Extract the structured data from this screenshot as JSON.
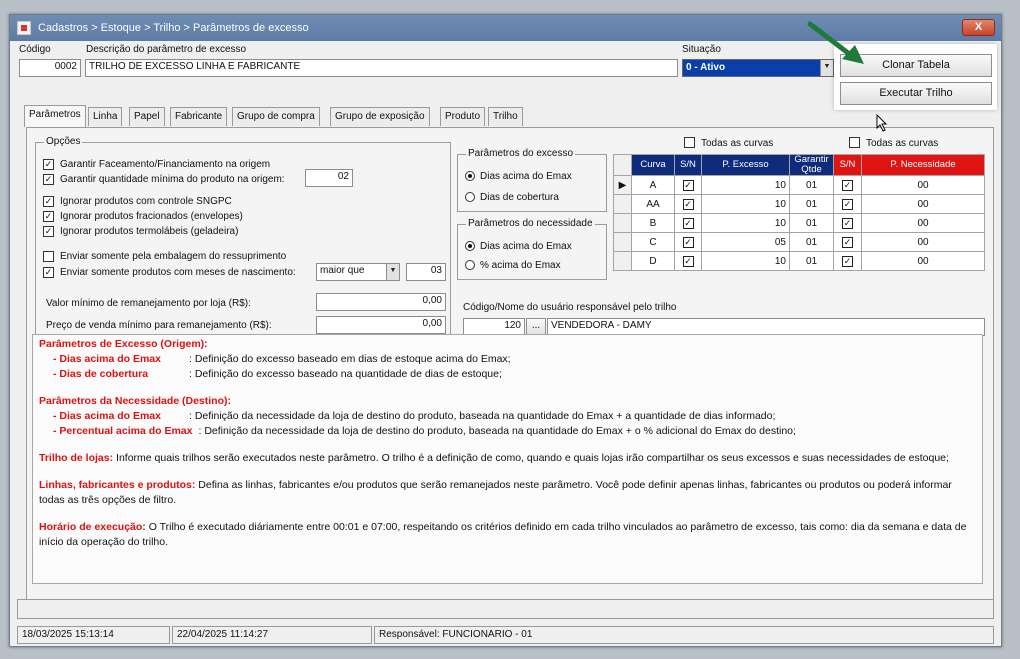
{
  "window": {
    "title": "Cadastros > Estoque > Trilho > Parâmetros de excesso",
    "close_label": "X"
  },
  "header": {
    "codigo_label": "Código",
    "codigo_value": "0002",
    "descricao_label": "Descrição do parâmetro de excesso",
    "descricao_value": "TRILHO DE EXCESSO LINHA E FABRICANTE",
    "situacao_label": "Situação",
    "situacao_value": "0 - Ativo"
  },
  "actions": {
    "clonar_label": "Clonar Tabela",
    "executar_label": "Executar Trilho"
  },
  "tabs": [
    "Parâmetros",
    "Linha",
    "Papel",
    "Fabricante",
    "Grupo de compra",
    "Grupo de exposição",
    "Produto",
    "Trilho"
  ],
  "opcoes": {
    "title": "Opções",
    "items": [
      {
        "label": "Garantir Faceamento/Financiamento na origem",
        "checked": true
      },
      {
        "label": "Garantir quantidade mínima do produto na origem:",
        "checked": true,
        "value": "02"
      },
      {
        "label": "Ignorar produtos com controle SNGPC",
        "checked": true
      },
      {
        "label": "Ignorar produtos fracionados (envelopes)",
        "checked": true
      },
      {
        "label": "Ignorar produtos termolábeis (geladeira)",
        "checked": true
      },
      {
        "label": "Enviar somente pela embalagem do ressuprimento",
        "checked": false
      },
      {
        "label": "Enviar somente produtos com meses de nascimento:",
        "checked": true,
        "select": "maior que",
        "value": "03"
      }
    ],
    "valor_minimo_label": "Valor mínimo de remanejamento por loja (R$):",
    "valor_minimo_value": "0,00",
    "preco_venda_label": "Preço de venda mínimo para remanejamento (R$):",
    "preco_venda_value": "0,00"
  },
  "param_excesso": {
    "title": "Parâmetros do excesso",
    "options": [
      "Dias acima do Emax",
      "Dias de cobertura"
    ],
    "selected": 0
  },
  "param_necessidade": {
    "title": "Parâmetros do necessidade",
    "options": [
      "Dias acima do Emax",
      "% acima do Emax"
    ],
    "selected": 0
  },
  "todas_curvas_1": "Todas as curvas",
  "todas_curvas_2": "Todas as curvas",
  "grid": {
    "headers": [
      "Curva",
      "S/N",
      "P. Excesso",
      "Garantir Qtde",
      "S/N",
      "P. Necessidade"
    ],
    "rows": [
      {
        "curva": "A",
        "sn1": true,
        "excesso": "10",
        "garantir": "01",
        "sn2": true,
        "necessidade": "00"
      },
      {
        "curva": "AA",
        "sn1": true,
        "excesso": "10",
        "garantir": "01",
        "sn2": true,
        "necessidade": "00"
      },
      {
        "curva": "B",
        "sn1": true,
        "excesso": "10",
        "garantir": "01",
        "sn2": true,
        "necessidade": "00"
      },
      {
        "curva": "C",
        "sn1": true,
        "excesso": "05",
        "garantir": "01",
        "sn2": true,
        "necessidade": "00"
      },
      {
        "curva": "D",
        "sn1": true,
        "excesso": "10",
        "garantir": "01",
        "sn2": true,
        "necessidade": "00"
      }
    ]
  },
  "usuario": {
    "label": "Código/Nome do usuário responsável pelo trilho",
    "codigo": "120",
    "lookup": "...",
    "nome": "VENDEDORA - DAMY"
  },
  "info": {
    "excesso_title": "Parâmetros de Excesso (Origem):",
    "excesso_items": [
      {
        "term": "- Dias acima do Emax",
        "desc": ": Definição do excesso baseado em dias de estoque acima do Emax;"
      },
      {
        "term": "- Dias de cobertura",
        "desc": ": Definição do excesso baseado na quantidade de dias de estoque;"
      }
    ],
    "necessidade_title": "Parâmetros da Necessidade (Destino):",
    "necessidade_items": [
      {
        "term": "- Dias acima do Emax",
        "desc": ": Definição da necessidade da loja de destino do produto, baseada na quantidade do Emax + a quantidade de dias informado;"
      },
      {
        "term": "- Percentual acima do Emax",
        "desc": ": Definição da necessidade da loja de destino do produto, baseada na quantidade do Emax + o % adicional do Emax do destino;"
      }
    ],
    "trilho_term": "Trilho de lojas:",
    "trilho_desc": " Informe quais trilhos serão executados neste parâmetro. O trilho é a definição de como, quando e quais lojas irão compartilhar os seus excessos e suas necessidades de estoque;",
    "linhas_term": "Linhas, fabricantes e produtos:",
    "linhas_desc": " Defina as linhas, fabricantes e/ou produtos que serão remanejados neste parâmetro. Você pode definir apenas linhas, fabricantes ou produtos ou poderá informar todas as três opções de filtro.",
    "horario_term": "Horário de execução:",
    "horario_desc": " O Trilho é executado diáriamente entre 00:01 e 07:00, respeitando os critérios definido em cada trilho vinculados ao parâmetro de excesso, tais como: dia da semana e data de início da operação do trilho."
  },
  "status": {
    "date1": "18/03/2025 15:13:14",
    "date2": "22/04/2025 11:14:27",
    "responsavel": "Responsável: FUNCIONARIO - 01"
  },
  "colors": {
    "titlebar": "#6682ad",
    "grid_header": "#0e2b7c",
    "grid_header_red": "#e11414",
    "info_red": "#dd1111",
    "arrow_green": "#1f7a3a"
  }
}
